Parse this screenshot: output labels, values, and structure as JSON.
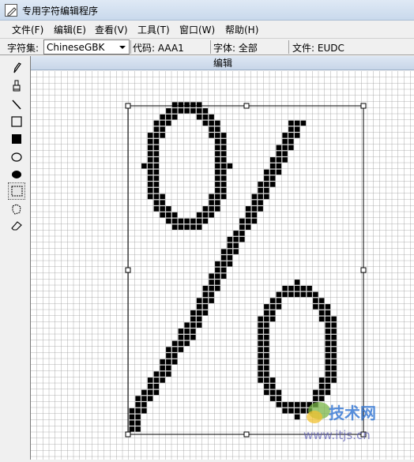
{
  "window": {
    "title": "专用字符编辑程序",
    "icon": "pencil-edit-icon"
  },
  "menu": [
    {
      "label": "文件(F)"
    },
    {
      "label": "编辑(E)"
    },
    {
      "label": "查看(V)"
    },
    {
      "label": "工具(T)"
    },
    {
      "label": "窗口(W)"
    },
    {
      "label": "帮助(H)"
    }
  ],
  "toolbar": {
    "charset_label": "字符集:",
    "charset_value": "ChineseGBK",
    "code_label": "代码: AAA1",
    "font_label": "字体: 全部",
    "file_label": "文件: EUDC"
  },
  "tools": [
    {
      "name": "pencil-tool",
      "icon": "pencil-icon"
    },
    {
      "name": "brush-tool",
      "icon": "brush-icon"
    },
    {
      "name": "line-tool",
      "icon": "line-icon"
    },
    {
      "name": "hollow-rectangle-tool",
      "icon": "hollow-rectangle-icon"
    },
    {
      "name": "filled-rectangle-tool",
      "icon": "filled-rectangle-icon"
    },
    {
      "name": "hollow-ellipse-tool",
      "icon": "hollow-ellipse-icon"
    },
    {
      "name": "filled-ellipse-tool",
      "icon": "filled-ellipse-icon"
    },
    {
      "name": "rect-select-tool",
      "icon": "rect-select-icon",
      "selected": true
    },
    {
      "name": "freeform-select-tool",
      "icon": "freeform-select-icon"
    },
    {
      "name": "eraser-tool",
      "icon": "eraser-icon"
    }
  ],
  "editor": {
    "caption": "编辑",
    "glyph": "%"
  },
  "watermark": {
    "text": "技术网",
    "url": "www.itjs.cn"
  }
}
